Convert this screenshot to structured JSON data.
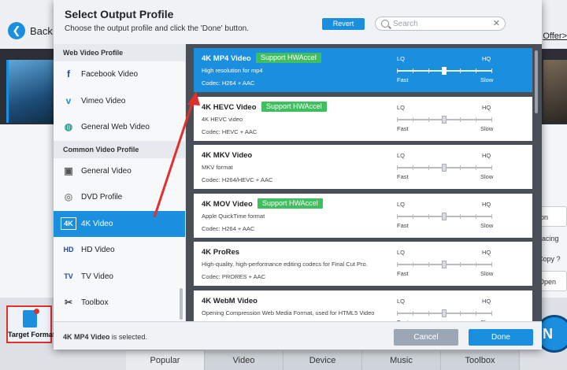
{
  "app": {
    "back_label": "Back",
    "offer_label": "Offer>",
    "right_list": [
      "ion",
      "rlacing",
      "Copy ?",
      "Open"
    ],
    "target_format_label": "Target Format",
    "run_label": "N",
    "bottom_tabs": [
      "Popular",
      "Video",
      "Device",
      "Music",
      "Toolbox"
    ]
  },
  "dialog": {
    "title": "Select Output Profile",
    "subtitle": "Choose the output profile and click the 'Done' button.",
    "revert_label": "Revert",
    "search": {
      "placeholder": "Search",
      "value": ""
    },
    "clear_glyph": "✕",
    "sidebar": {
      "categories": [
        {
          "name": "Web Video Profile",
          "items": [
            {
              "label": "Facebook Video",
              "icon": "facebook-icon",
              "glyph": "f",
              "color": "#1e4b9c"
            },
            {
              "label": "Vimeo Video",
              "icon": "vimeo-icon",
              "glyph": "v",
              "color": "#1a8fe0"
            },
            {
              "label": "General Web Video",
              "icon": "globe-icon",
              "glyph": "◍",
              "color": "#2a9d8f"
            }
          ]
        },
        {
          "name": "Common Video Profile",
          "items": [
            {
              "label": "General Video",
              "icon": "film-icon",
              "glyph": "▣",
              "color": "#555555"
            },
            {
              "label": "DVD Profile",
              "icon": "dvd-icon",
              "glyph": "◎",
              "color": "#888888"
            },
            {
              "label": "4K Video",
              "icon": "4k-icon",
              "glyph": "4K",
              "color": "#ffffff",
              "active": true
            },
            {
              "label": "HD Video",
              "icon": "hd-icon",
              "glyph": "HD",
              "color": "#1e4b9c"
            },
            {
              "label": "TV Video",
              "icon": "tv-icon",
              "glyph": "TV",
              "color": "#1e4b9c"
            },
            {
              "label": "Toolbox",
              "icon": "toolbox-icon",
              "glyph": "✂",
              "color": "#444444"
            }
          ]
        }
      ]
    },
    "profiles": [
      {
        "name": "4K MP4 Video",
        "hw": "Support HWAccel",
        "desc": "High resolution for mp4",
        "codec": "Codec: H264 + AAC",
        "quality": 0.5,
        "active": true
      },
      {
        "name": "4K HEVC Video",
        "hw": "Support HWAccel",
        "desc": "4K HEVC video",
        "codec": "Codec: HEVC + AAC",
        "quality": 0.5
      },
      {
        "name": "4K MKV Video",
        "hw": "",
        "desc": "MKV format",
        "codec": "Codec: H264/HEVC + AAC",
        "quality": 0.5
      },
      {
        "name": "4K MOV Video",
        "hw": "Support HWAccel",
        "desc": "Apple QuickTime format",
        "codec": "Codec: H264 + AAC",
        "quality": 0.5
      },
      {
        "name": "4K ProRes",
        "hw": "",
        "desc": "High-quality, high-performance editing codecs for Final Cut Pro.",
        "codec": "Codec: PRORES + AAC",
        "quality": 0.5
      },
      {
        "name": "4K WebM Video",
        "hw": "",
        "desc": "Opening Compression Web Media Format, used for HTML5 Video",
        "codec": "",
        "quality": 0.5
      }
    ],
    "slider_labels": {
      "lq": "LQ",
      "hq": "HQ",
      "fast": "Fast",
      "slow": "Slow"
    },
    "footer": {
      "selected_name": "4K MP4 Video",
      "selected_suffix": " is selected.",
      "cancel_label": "Cancel",
      "done_label": "Done"
    }
  },
  "colors": {
    "accent": "#1a8fe0",
    "hw_badge": "#3fbf5f",
    "annotation": "#e0302d"
  }
}
